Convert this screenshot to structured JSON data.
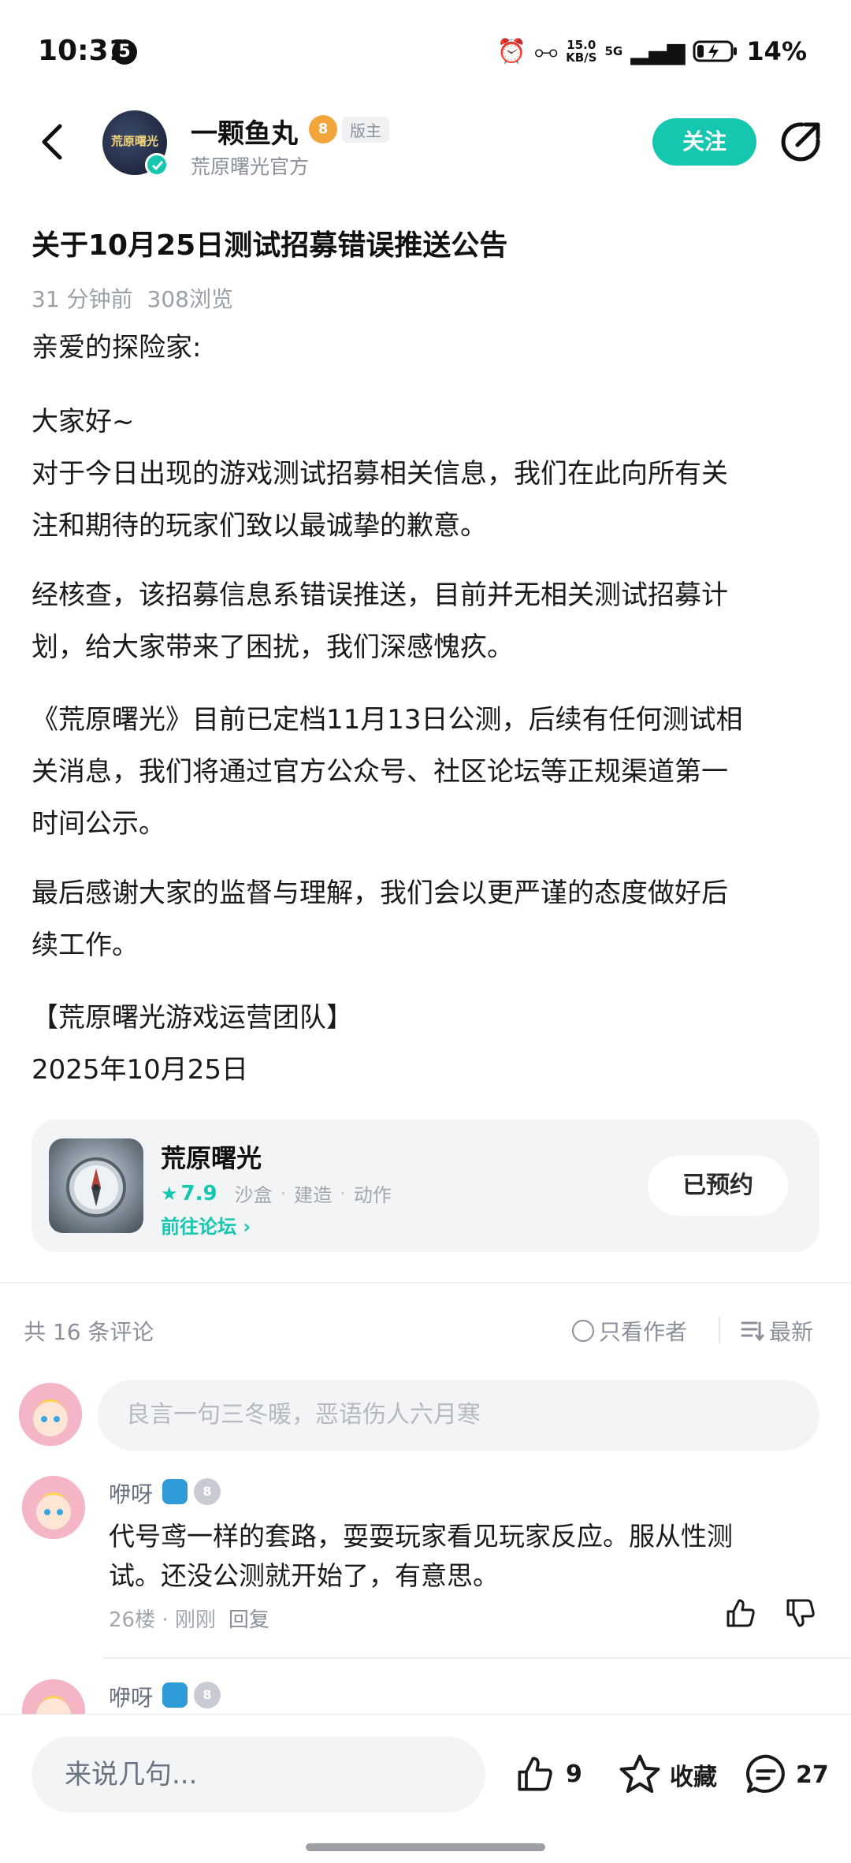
{
  "status_bar": {
    "time": "10:31",
    "notification_count": "5",
    "net_speed_value": "15.0",
    "net_speed_unit": "KB/S",
    "network": "5G",
    "battery": "14%"
  },
  "header": {
    "author_name": "一颗鱼丸",
    "level": "8",
    "role": "版主",
    "author_subtitle": "荒原曙光官方",
    "avatar_text": "荒原曙光",
    "follow_label": "关注"
  },
  "article": {
    "title": "关于10月25日测试招募错误推送公告",
    "time_ago": "31 分钟前",
    "views": "308浏览",
    "greeting": "亲爱的探险家:",
    "p1_line1": "大家好~",
    "p1_line2": "对于今日出现的游戏测试招募相关信息，我们在此向所有关",
    "p1_line3": "注和期待的玩家们致以最诚挚的歉意。",
    "p2_line1": "经核查，该招募信息系错误推送，目前并无相关测试招募计",
    "p2_line2": "划，给大家带来了困扰，我们深感愧疚。",
    "p3_line1": "《荒原曙光》目前已定档11月13日公测，后续有任何测试相",
    "p3_line2": "关消息，我们将通过官方公众号、社区论坛等正规渠道第一",
    "p3_line3": "时间公示。",
    "p4_line1": "最后感谢大家的监督与理解，我们会以更严谨的态度做好后",
    "p4_line2": "续工作。",
    "signature": "【荒原曙光游戏运营团队】",
    "date": "2025年10月25日"
  },
  "game_card": {
    "name": "荒原曙光",
    "rating": "7.9",
    "tags": [
      "沙盒",
      "建造",
      "动作"
    ],
    "forum_link": "前往论坛",
    "reserve_label": "已预约"
  },
  "comments": {
    "count_label": "共 16 条评论",
    "author_only_label": "只看作者",
    "sort_label": "最新",
    "input_placeholder": "良言一句三冬暖，恶语伤人六月寒",
    "items": [
      {
        "user": "咿呀",
        "level": "8",
        "text_line1": "代号鸢一样的套路，耍耍玩家看见玩家反应。服从性测",
        "text_line2": "试。还没公测就开始了，有意思。",
        "floor": "26楼 · 刚刚",
        "reply_label": "回复"
      },
      {
        "user": "咿呀",
        "level": "8"
      }
    ]
  },
  "bottom_bar": {
    "input_placeholder": "来说几句...",
    "likes": "9",
    "favorite_label": "收藏",
    "comment_count": "27"
  },
  "colors": {
    "accent": "#16c7b0",
    "text_primary": "#1a1a1a",
    "text_secondary": "#8a8f99",
    "card_bg": "#f3f4f6"
  }
}
